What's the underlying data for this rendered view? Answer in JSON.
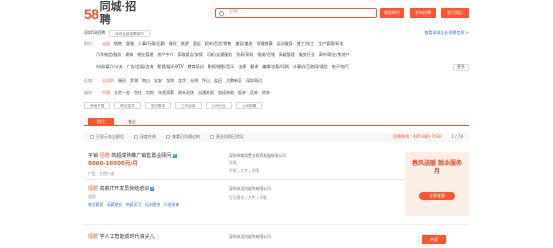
{
  "header": {
    "logo_num": "58",
    "logo_sep": "同城·",
    "logo_name": "招聘",
    "search_placeholder": "招聘",
    "search_button": "搜索职位",
    "publish_button": "发布招聘",
    "login_button": "登记简历"
  },
  "location": {
    "city": "深圳58招聘",
    "location_select": "深圳全部招聘城市",
    "help_link": "查看深圳企业招聘信息 >"
  },
  "industry_row": {
    "label": "职位：",
    "items": [
      "全部",
      "销售",
      "客服",
      "人事/行政/后勤",
      "餐饮",
      "旅游",
      "酒店",
      "超市/百货/零售",
      "美容/美发",
      "保健按摩",
      "运动健身",
      "普工/技工",
      "生产管理/研发"
    ]
  },
  "industry_row2": {
    "items": [
      "汽车制造/服务",
      "建筑",
      "物业管理",
      "房产中介",
      "家政保洁/安保",
      "司机/交通服务",
      "贸易/采购",
      "物流/仓储",
      "高级管理",
      "服务行业",
      "高中/职业/房地产"
    ]
  },
  "industry_row3": {
    "items": [
      "市场/媒介/公关",
      "广告/会展/咨询",
      "影视/娱乐/KTV",
      "教育培训",
      "影视/摄影/音乐",
      "法律",
      "翻译",
      "编辑/出版/印刷",
      "计算机/互联网/通信",
      "电子/电气"
    ],
    "more": "更多"
  },
  "area_row": {
    "label": "区域：",
    "items": [
      "全深圳",
      "福田",
      "罗湖",
      "南山",
      "宝安",
      "龙岗",
      "龙华",
      "光明",
      "坪山",
      "盐田",
      "大鹏新区",
      "深圳周边"
    ]
  },
  "salary_row": {
    "label": "福利：",
    "items": [
      "不限",
      "五险一金",
      "包住",
      "包吃",
      "年底双薪",
      "周末双休",
      "交通补助",
      "加班补助",
      "饭补",
      "话补",
      "房补"
    ]
  },
  "filters": {
    "items": [
      "其他不限",
      "职位性质",
      "学历要求",
      "工作经验",
      "公司行业",
      "公司规模"
    ]
  },
  "tabs": {
    "active": "职位",
    "other": "名企"
  },
  "filterbar": {
    "items": [
      "只显示名企职位",
      "深度在线",
      "查看已沟通过的",
      "职位",
      "营业执照已验证"
    ],
    "right_link": "猜你喜欢",
    "phone": "招聘热线：400-880-7530",
    "page": "1",
    "pages": "70"
  },
  "jobs": [
    {
      "type": "平销",
      "tag": "招聘",
      "title": "商超成熟推广销售置业顾问",
      "salary": "8000-16000元/月",
      "welfare": [
        "广告",
        "五险一金"
      ],
      "company": "深圳市商润置业投资发展有限公司",
      "company_tags": [
        "社保"
      ],
      "edu": [
        "不限",
        "大专",
        "不限"
      ],
      "apply": "申请"
    },
    {
      "type": "招聘",
      "tag": "",
      "title": "高薪IT开发员快结培训",
      "salary": "深圳",
      "welfare": [
        "就业薪资",
        "高薪就业",
        "带薪实习",
        "培训提供",
        "小班授课"
      ],
      "company": "深圳市达内软件有限公司",
      "company_tags": [
        "认证"
      ],
      "edu": [
        "打分要求",
        "大专",
        "不限"
      ],
      "apply": "申请"
    },
    {
      "type": "招聘",
      "tag": "",
      "title": "学人工智能成时代浪尖儿",
      "salary": "",
      "welfare": [],
      "company": "深圳市达内软件有限公司",
      "company_tags": [],
      "edu": [],
      "apply": "申请"
    }
  ],
  "ad": {
    "title": "春风送暖 就业服务月",
    "button": "立即查看"
  }
}
